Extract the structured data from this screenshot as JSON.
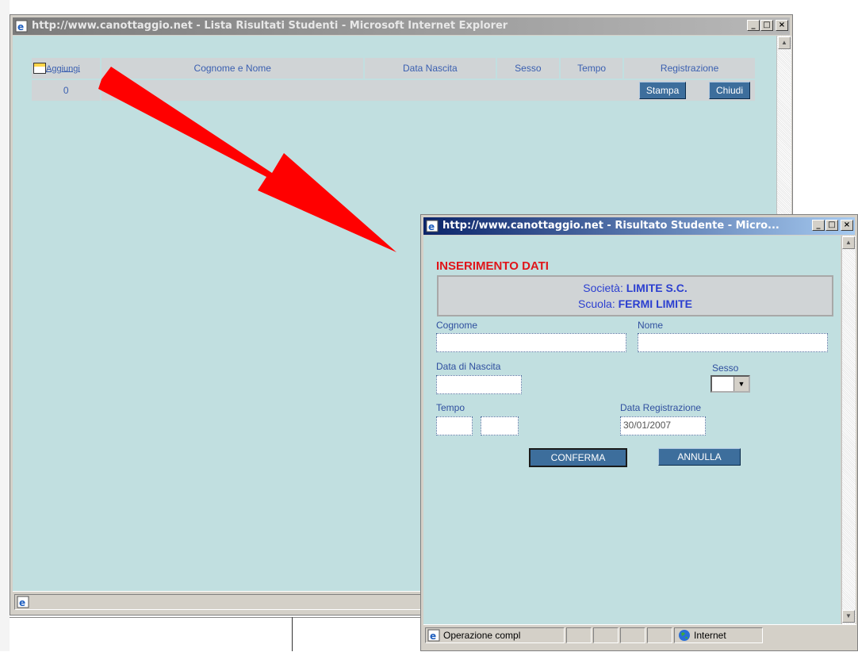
{
  "list_window": {
    "title": "http://www.canottaggio.net - Lista Risultati Studenti - Microsoft Internet Explorer",
    "headers": [
      "Cognome e Nome",
      "Data Nascita",
      "Sesso",
      "Tempo",
      "Registrazione"
    ],
    "add_label": "Aggiungi",
    "count": "0",
    "print_label": "Stampa",
    "close_label": "Chiudi"
  },
  "form_window": {
    "title": "http://www.canottaggio.net - Risultato Studente - Micro...",
    "heading": "INSERIMENTO DATI",
    "societa_label": "Società:",
    "societa_value": "LIMITE S.C.",
    "scuola_label": "Scuola:",
    "scuola_value": "FERMI LIMITE",
    "cognome_label": "Cognome",
    "nome_label": "Nome",
    "nascita_label": "Data di Nascita",
    "sesso_label": "Sesso",
    "tempo_label": "Tempo",
    "registrazione_label": "Data Registrazione",
    "registrazione_value": "30/01/2007",
    "confirm_label": "CONFERMA",
    "cancel_label": "ANNULLA",
    "status_text": "Operazione compl",
    "zone_text": "Internet"
  },
  "icons": [
    "ie-page-icon",
    "add-table-icon",
    "globe-icon",
    "red-arrow"
  ],
  "colors": {
    "heading": "#e0151a",
    "value": "#2b3fd0",
    "label": "#2f4f9f",
    "client_bg": "#c1dfe0",
    "button": "#3d6e9c"
  }
}
